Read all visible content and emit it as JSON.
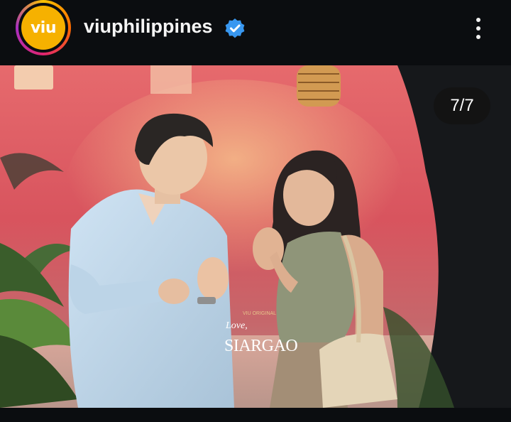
{
  "header": {
    "avatar_text": "viu",
    "username": "viuphilippines",
    "verified_icon": "verified-badge-icon",
    "more_icon": "more-vertical-icon"
  },
  "post": {
    "counter": "7/7",
    "watermark": {
      "line1": "VIU ORIGINAL",
      "line2": "Love,",
      "line3": "SIARGAO"
    }
  },
  "colors": {
    "background": "#0b0d10",
    "viu_yellow": "#f6b100",
    "verified_blue": "#3897f0"
  }
}
